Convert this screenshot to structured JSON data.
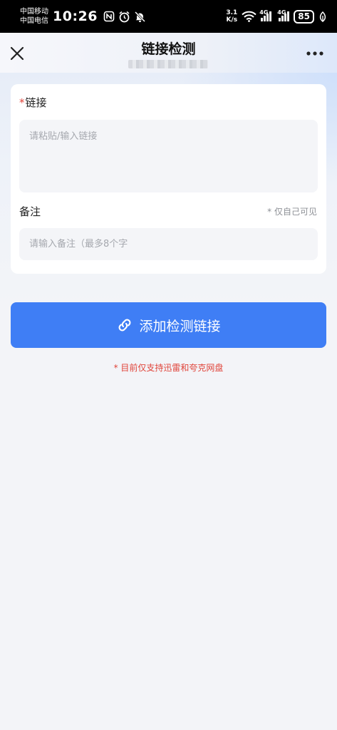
{
  "status_bar": {
    "carrier_1": "中国移动",
    "carrier_2": "中国电信",
    "time": "10:26",
    "net_speed_value": "3.1",
    "net_speed_unit": "K/s",
    "network_1": "4G",
    "network_2": "4G",
    "battery": "85"
  },
  "header": {
    "title": "链接检测"
  },
  "form": {
    "link_required_mark": "*",
    "link_label": "链接",
    "link_placeholder": "请粘贴/输入链接",
    "note_label": "备注",
    "note_privacy_hint": "* 仅自己可见",
    "note_placeholder": "请输入备注（最多8个字"
  },
  "submit": {
    "label": "添加检测链接"
  },
  "footer_note": "* 目前仅支持迅雷和夸克网盘",
  "colors": {
    "accent": "#3f7ef5",
    "required": "#e0443a",
    "background": "#f3f4f8"
  },
  "icons": {
    "close": "close-icon",
    "more": "more-dots-icon",
    "link": "link-icon"
  }
}
